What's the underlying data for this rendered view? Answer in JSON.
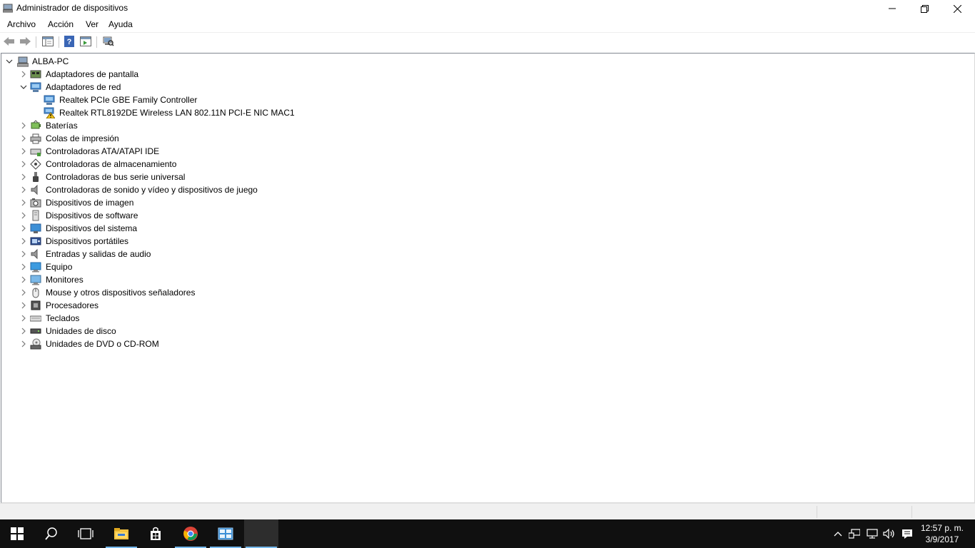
{
  "window": {
    "title": "Administrador de dispositivos"
  },
  "menu": {
    "items": [
      "Archivo",
      "Acción",
      "Ver",
      "Ayuda"
    ]
  },
  "tree": {
    "root": "ALBA-PC",
    "nodes": [
      {
        "label": "Adaptadores de pantalla",
        "expanded": false,
        "icon": "display-adapter-icon"
      },
      {
        "label": "Adaptadores de red",
        "expanded": true,
        "icon": "network-adapter-icon"
      },
      {
        "label": "Realtek PCIe GBE Family Controller",
        "child": true,
        "icon": "network-card-icon"
      },
      {
        "label": "Realtek RTL8192DE Wireless LAN 802.11N PCI-E NIC MAC1",
        "child": true,
        "icon": "network-card-warning-icon"
      },
      {
        "label": "Baterías",
        "expanded": false,
        "icon": "battery-icon"
      },
      {
        "label": "Colas de impresión",
        "expanded": false,
        "icon": "printer-icon"
      },
      {
        "label": "Controladoras ATA/ATAPI IDE",
        "expanded": false,
        "icon": "ide-controller-icon"
      },
      {
        "label": "Controladoras de almacenamiento",
        "expanded": false,
        "icon": "storage-controller-icon"
      },
      {
        "label": "Controladoras de bus serie universal",
        "expanded": false,
        "icon": "usb-icon"
      },
      {
        "label": "Controladoras de sonido y vídeo y dispositivos de juego",
        "expanded": false,
        "icon": "speaker-icon"
      },
      {
        "label": "Dispositivos de imagen",
        "expanded": false,
        "icon": "camera-icon"
      },
      {
        "label": "Dispositivos de software",
        "expanded": false,
        "icon": "software-device-icon"
      },
      {
        "label": "Dispositivos del sistema",
        "expanded": false,
        "icon": "system-device-icon"
      },
      {
        "label": "Dispositivos portátiles",
        "expanded": false,
        "icon": "portable-device-icon"
      },
      {
        "label": "Entradas y salidas de audio",
        "expanded": false,
        "icon": "audio-io-icon"
      },
      {
        "label": "Equipo",
        "expanded": false,
        "icon": "computer-icon"
      },
      {
        "label": "Monitores",
        "expanded": false,
        "icon": "monitor-icon"
      },
      {
        "label": "Mouse y otros dispositivos señaladores",
        "expanded": false,
        "icon": "mouse-icon"
      },
      {
        "label": "Procesadores",
        "expanded": false,
        "icon": "processor-icon"
      },
      {
        "label": "Teclados",
        "expanded": false,
        "icon": "keyboard-icon"
      },
      {
        "label": "Unidades de disco",
        "expanded": false,
        "icon": "disk-drive-icon"
      },
      {
        "label": "Unidades de DVD o CD-ROM",
        "expanded": false,
        "icon": "dvd-drive-icon"
      }
    ]
  },
  "taskbar": {
    "clock_time": "12:57 p. m.",
    "clock_date": "3/9/2017"
  },
  "colors": {
    "taskbar_bg": "#101010",
    "accent": "#76b9ed",
    "folder": "#f3c342"
  }
}
